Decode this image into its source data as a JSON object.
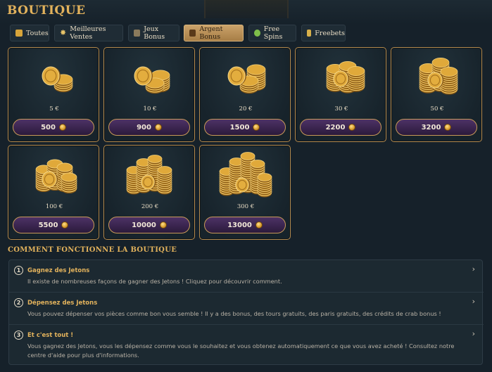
{
  "page": {
    "title": "BOUTIQUE"
  },
  "tabs": [
    {
      "label": "Toutes",
      "icon": "coins-icon",
      "active": false
    },
    {
      "label": "Meilleures Ventes",
      "icon": "star-icon",
      "active": false
    },
    {
      "label": "Jeux Bonus",
      "icon": "dice-icon",
      "active": false
    },
    {
      "label": "Argent Bonus",
      "icon": "cash-icon",
      "active": true
    },
    {
      "label": "Free Spins",
      "icon": "spin-icon",
      "active": false
    },
    {
      "label": "Freebets",
      "icon": "ticket-icon",
      "active": false
    }
  ],
  "products": [
    {
      "price": "5 €",
      "cost": "500",
      "stack_level": 1
    },
    {
      "price": "10 €",
      "cost": "900",
      "stack_level": 2
    },
    {
      "price": "20 €",
      "cost": "1500",
      "stack_level": 3
    },
    {
      "price": "30 €",
      "cost": "2200",
      "stack_level": 4
    },
    {
      "price": "50 €",
      "cost": "3200",
      "stack_level": 5
    },
    {
      "price": "100 €",
      "cost": "5500",
      "stack_level": 6
    },
    {
      "price": "200 €",
      "cost": "10000",
      "stack_level": 7
    },
    {
      "price": "300 €",
      "cost": "13000",
      "stack_level": 8
    }
  ],
  "how_it_works": {
    "title": "COMMENT FONCTIONNE LA BOUTIQUE",
    "items": [
      {
        "number": "1",
        "question": "Gagnez des Jetons",
        "answer": "Il existe de nombreuses façons de gagner des Jetons ! Cliquez pour découvrir comment."
      },
      {
        "number": "2",
        "question": "Dépensez des Jetons",
        "answer": "Vous pouvez dépenser vos pièces comme bon vous semble ! Il y a des bonus, des tours gratuits, des paris gratuits, des crédits de crab bonus !"
      },
      {
        "number": "3",
        "question": "Et c'est tout !",
        "answer": "Vous gagnez des Jetons, vous les dépensez comme vous le souhaitez et vous obtenez automatiquement ce que vous avez acheté ! Consultez notre centre d'aide pour plus d'informations."
      }
    ]
  },
  "colors": {
    "accent_gold": "#e2b25c",
    "card_border": "#b48a4e",
    "button_purple": "#3b2650",
    "background": "#16212a"
  }
}
